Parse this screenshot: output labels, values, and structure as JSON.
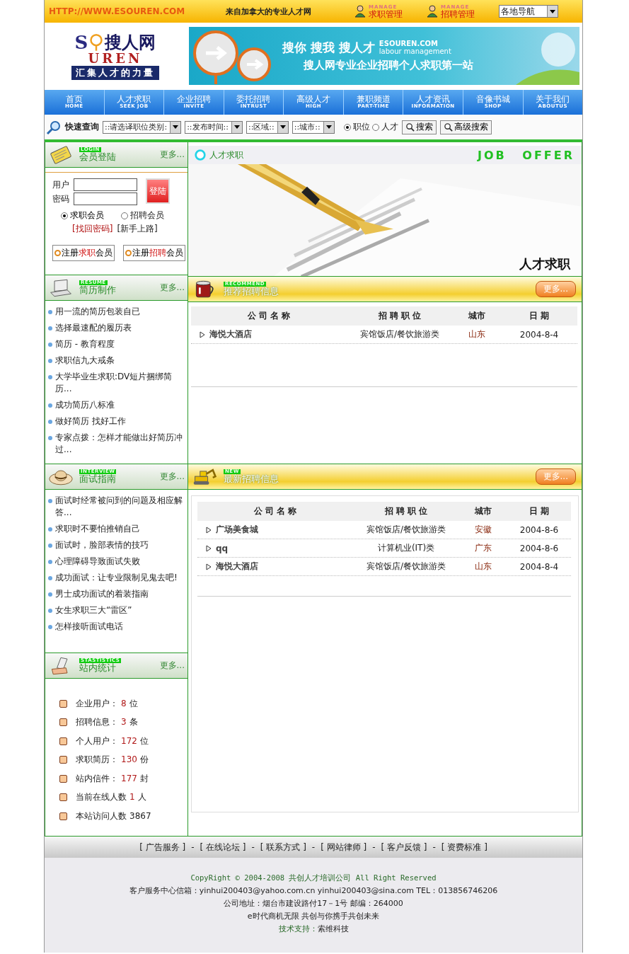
{
  "top_bar": {
    "url": "HTTP://WWW.ESOUREN.COM",
    "tagline": "来自加拿大的专业人才网",
    "manage_links": [
      {
        "sub": "MANAGE",
        "label": "求职管理"
      },
      {
        "sub": "MANAGE",
        "label": "招聘管理"
      }
    ],
    "region_select": "各地导航"
  },
  "logo": {
    "letter_left": "S",
    "letters_right": "UREN",
    "name": "搜人网",
    "slogan": "汇集人才的力量"
  },
  "banner": {
    "slogan_1": "搜你 搜我 搜人才",
    "domain": "ESOUREN.COM",
    "subtitle": "labour management",
    "slogan_2": "搜人网专业企业招聘个人求职第一站"
  },
  "nav": [
    {
      "label": "首页",
      "sub": "HOME"
    },
    {
      "label": "人才求职",
      "sub": "SEEK JOB"
    },
    {
      "label": "企业招聘",
      "sub": "INVITE"
    },
    {
      "label": "委托招聘",
      "sub": "INTRUST"
    },
    {
      "label": "高级人才",
      "sub": "HIGH"
    },
    {
      "label": "兼职频道",
      "sub": "PART-TIME"
    },
    {
      "label": "人才资讯",
      "sub": "INFORMATION"
    },
    {
      "label": "音像书城",
      "sub": "SHOP"
    },
    {
      "label": "关于我们",
      "sub": "ABOUTUS"
    }
  ],
  "quick_search": {
    "label": "快速查询",
    "selects": [
      "::请选译职位类别:",
      "::发布时间::",
      "::区域::",
      "::城市::"
    ],
    "radios": [
      {
        "label": "职位",
        "selected": true
      },
      {
        "label": "人才",
        "selected": false
      }
    ],
    "buttons": [
      "搜索",
      "高级搜索"
    ]
  },
  "login": {
    "sub": "LOGIN",
    "title": "会员登陆",
    "more": "更多...",
    "fields": [
      {
        "label": "用户"
      },
      {
        "label": "密码"
      }
    ],
    "submit": "登陆",
    "member_types": [
      {
        "label": "求职会员",
        "selected": true
      },
      {
        "label": "招聘会员",
        "selected": false
      }
    ],
    "links": [
      {
        "text": "[找回密码]",
        "kind": "alert"
      },
      {
        "text": "[新手上路]",
        "kind": "plain"
      }
    ],
    "register_buttons": [
      {
        "before": "注册",
        "highlight": "求职",
        "after": "会员"
      },
      {
        "before": "注册",
        "highlight": "招聘",
        "after": "会员"
      }
    ]
  },
  "job_offer": {
    "title": "人才求职",
    "sub": "JOB OFFER",
    "caption": "人才求职"
  },
  "resume": {
    "sub": "RESUME",
    "title": "简历制作",
    "more": "更多...",
    "items": [
      "用一流的简历包装自已",
      "选择最速配的履历表",
      "简历 - 教育程度",
      "求职信九大戒条",
      "大学毕业生求职:DV短片捆绑简历...",
      "成功简历八标准",
      "做好简历 找好工作",
      "专家点拨：怎样才能做出好简历冲过..."
    ]
  },
  "recommended_jobs": {
    "sub": "RECOMMEND",
    "title": "推荐招聘信息",
    "more": "更多...",
    "columns": [
      "公 司 名 称",
      "招 聘 职 位",
      "城市",
      "日 期"
    ],
    "rows": [
      {
        "company": "海悦大酒店",
        "position": "宾馆饭店/餐饮旅游类",
        "city": "山东",
        "date": "2004-8-4"
      }
    ]
  },
  "interview": {
    "sub": "INTERVIEW",
    "title": "面试指南",
    "more": "更多...",
    "items": [
      "面试时经常被问到的问题及相应解答...",
      "求职时不要怕推销自己",
      "面试时，脸部表情的技巧",
      "心理障碍导致面试失败",
      "成功面试：让专业限制见鬼去吧!",
      "男士成功面试的着装指南",
      "女生求职三大“雷区”",
      "怎样接听面试电话"
    ]
  },
  "new_jobs": {
    "sub": "NEW",
    "title": "最新招聘信息",
    "more": "更多...",
    "columns": [
      "公 司 名 称",
      "招 聘 职 位",
      "城市",
      "日 期"
    ],
    "rows": [
      {
        "company": "广场美食城",
        "position": "宾馆饭店/餐饮旅游类",
        "city": "安徽",
        "date": "2004-8-6"
      },
      {
        "company": "qq",
        "position": "计算机业(IT)类",
        "city": "广东",
        "date": "2004-8-6"
      },
      {
        "company": "海悦大酒店",
        "position": "宾馆饭店/餐饮旅游类",
        "city": "山东",
        "date": "2004-8-4"
      }
    ]
  },
  "statistics": {
    "sub": "STASTISTICS",
    "title": "站内统计",
    "more": "更多...",
    "items": [
      {
        "label": "企业用户：",
        "value": "8",
        "unit": "位",
        "highlight": true
      },
      {
        "label": "招聘信息：",
        "value": "3",
        "unit": "条",
        "highlight": true
      },
      {
        "label": "个人用户：",
        "value": "172",
        "unit": "位",
        "highlight": true
      },
      {
        "label": "求职简历：",
        "value": "130",
        "unit": "份",
        "highlight": true
      },
      {
        "label": "站内信件：",
        "value": "177",
        "unit": "封",
        "highlight": true
      },
      {
        "label": "当前在线人数",
        "value": "1",
        "unit": "人",
        "highlight": true
      },
      {
        "label": "本站访问人数",
        "value": "3867",
        "highlight": false
      }
    ]
  },
  "footer": {
    "links": [
      "[ 广告服务 ]",
      "[ 在线论坛 ]",
      "[ 联系方式 ]",
      "[ 网站律师 ]",
      "[ 客户反馈 ]",
      "[ 资费标准 ]"
    ],
    "separator": "-",
    "copyright": "CopyRight © 2004-2008 共创人才培训公司 All Right Reserved",
    "lines": [
      "客户服务中心信箱：yinhui200403@yahoo.com.cn yinhui200403@sina.com TEL：013856746206",
      "公司地址：烟台市建设路付17－1号 邮编：264000",
      "e时代商机无限 共创与你携手共创未来"
    ],
    "support_label": "技术支持：",
    "support_value": "索维科技"
  }
}
